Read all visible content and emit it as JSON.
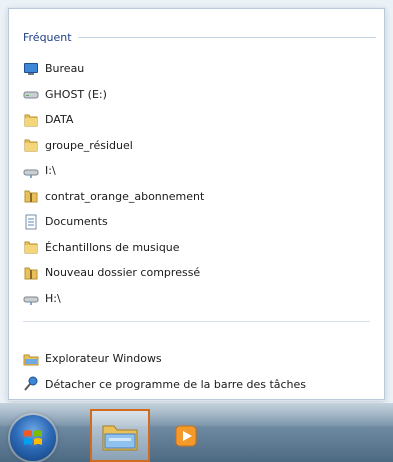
{
  "jumplist": {
    "section_title": "Fréquent",
    "items": [
      {
        "label": "Bureau",
        "icon": "desktop-icon"
      },
      {
        "label": "GHOST (E:)",
        "icon": "drive-icon"
      },
      {
        "label": "DATA",
        "icon": "folder-icon"
      },
      {
        "label": "groupe_résiduel",
        "icon": "folder-icon"
      },
      {
        "label": "I:\\",
        "icon": "network-drive-icon"
      },
      {
        "label": "contrat_orange_abonnement",
        "icon": "zip-folder-icon"
      },
      {
        "label": "Documents",
        "icon": "documents-icon"
      },
      {
        "label": "Échantillons de musique",
        "icon": "folder-icon"
      },
      {
        "label": "Nouveau dossier compressé",
        "icon": "zip-folder-icon"
      },
      {
        "label": "H:\\",
        "icon": "network-drive-icon"
      }
    ],
    "tasks": [
      {
        "label": "Explorateur Windows",
        "icon": "explorer-icon"
      },
      {
        "label": "Détacher ce programme de la barre des tâches",
        "icon": "unpin-icon"
      }
    ]
  },
  "taskbar": {
    "start_icon": "windows-flag-icon",
    "pinned": [
      {
        "icon": "explorer-icon",
        "active": true
      },
      {
        "icon": "media-player-icon",
        "active": false
      }
    ]
  },
  "colors": {
    "section_title": "#1e3f8a",
    "active_border": "#d06b1f",
    "folder_yellow": "#e8c15a"
  }
}
